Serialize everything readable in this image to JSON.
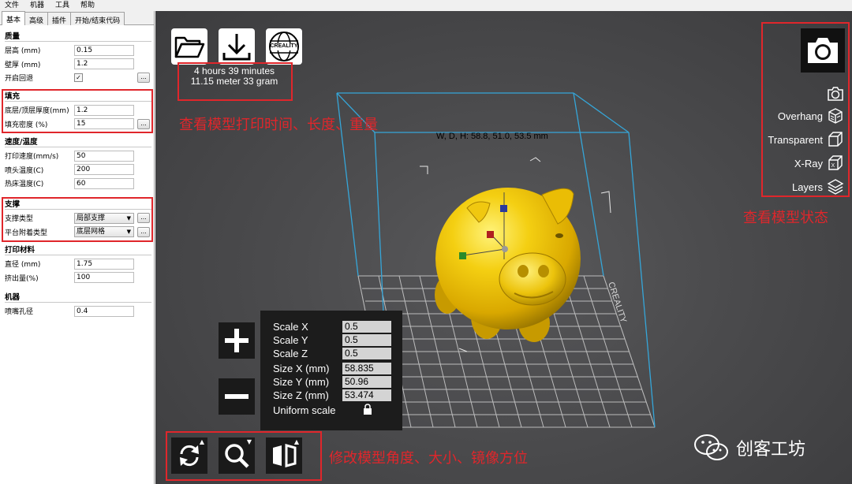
{
  "menu": [
    "文件",
    "机器",
    "工具",
    "帮助"
  ],
  "tabs": [
    "基本",
    "高级",
    "插件",
    "开始/结束代码"
  ],
  "quality": {
    "title": "质量",
    "layer_height_label": "层高 (mm)",
    "layer_height": "0.15",
    "shell_label": "壁厚 (mm)",
    "shell": "1.2",
    "retraction_label": "开启回退",
    "retraction_checked": "✓"
  },
  "fill": {
    "title": "填充",
    "bottom_top_label": "底层/顶层厚度(mm)",
    "bottom_top": "1.2",
    "density_label": "填充密度 (%)",
    "density": "15"
  },
  "speed": {
    "title": "速度/温度",
    "print_speed_label": "打印速度(mm/s)",
    "print_speed": "50",
    "nozzle_temp_label": "喷头温度(C)",
    "nozzle_temp": "200",
    "bed_temp_label": "热床温度(C)",
    "bed_temp": "60"
  },
  "support": {
    "title": "支撑",
    "type_label": "支撑类型",
    "type": "局部支撑",
    "adhesion_label": "平台附着类型",
    "adhesion": "底层网格"
  },
  "filament": {
    "title": "打印材料",
    "diameter_label": "直径 (mm)",
    "diameter": "1.75",
    "flow_label": "挤出量(%)",
    "flow": "100"
  },
  "machine": {
    "title": "机器",
    "nozzle_label": "喷嘴孔径",
    "nozzle": "0.4"
  },
  "more_button_label": "...",
  "print_info": {
    "time": "4 hours 39 minutes",
    "usage": "11.15 meter 33 gram"
  },
  "logo_text": "CREALITY",
  "model_dims": "W, D, H: 58.8, 51.0, 53.5 mm",
  "annotations": {
    "top": "查看模型打印时间、长度、重量",
    "right": "查看模型状态",
    "bottom": "修改模型角度、大小、镜像方位"
  },
  "view_modes": [
    "Overhang",
    "Transparent",
    "X-Ray",
    "Layers"
  ],
  "scale": {
    "scale_x_label": "Scale X",
    "scale_x": "0.5",
    "scale_y_label": "Scale Y",
    "scale_y": "0.5",
    "scale_z_label": "Scale Z",
    "scale_z": "0.5",
    "size_x_label": "Size X (mm)",
    "size_x": "58.835",
    "size_y_label": "Size Y (mm)",
    "size_y": "50.96",
    "size_z_label": "Size Z (mm)",
    "size_z": "53.474",
    "uniform_label": "Uniform scale"
  },
  "watermark": "创客工坊",
  "colors": {
    "accent_red": "#e0262b",
    "model_yellow": "#f2c100",
    "volume_line": "#35a6d9"
  }
}
